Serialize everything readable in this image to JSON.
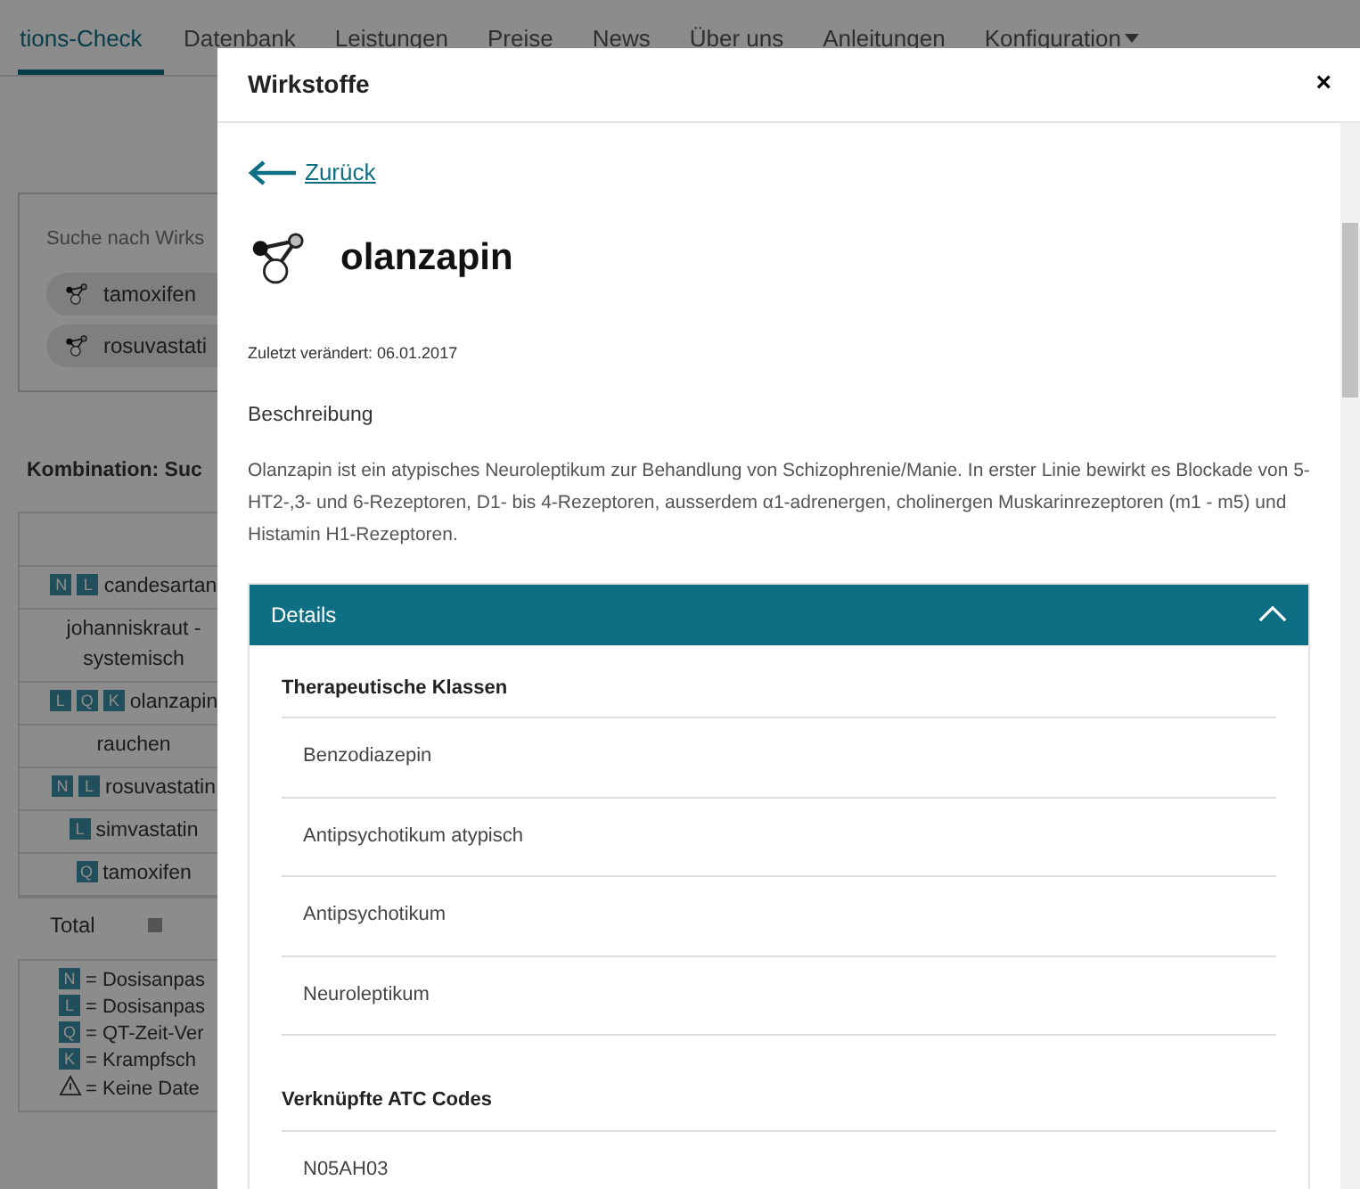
{
  "navbar": {
    "items": [
      {
        "label": "tions-Check",
        "selected": true,
        "has_menu": false
      },
      {
        "label": "Datenbank",
        "selected": false,
        "has_menu": false
      },
      {
        "label": "Leistungen",
        "selected": false,
        "has_menu": false
      },
      {
        "label": "Preise",
        "selected": false,
        "has_menu": false
      },
      {
        "label": "News",
        "selected": false,
        "has_menu": false
      },
      {
        "label": "Über uns",
        "selected": false,
        "has_menu": false
      },
      {
        "label": "Anleitungen",
        "selected": false,
        "has_menu": false
      },
      {
        "label": "Konfiguration",
        "selected": false,
        "has_menu": true
      }
    ]
  },
  "search": {
    "placeholder": "Suche nach Wirks"
  },
  "chips": [
    {
      "label": "tamoxifen"
    },
    {
      "label": "rosuvastati"
    }
  ],
  "combination_title": "Kombination: Suc",
  "table": {
    "rows": [
      {
        "badges": [
          "N",
          "L"
        ],
        "name": "candesartan"
      },
      {
        "badges": [],
        "name": "johanniskraut - systemisch"
      },
      {
        "badges": [
          "L",
          "Q",
          "K"
        ],
        "name": "olanzapin"
      },
      {
        "badges": [],
        "name": "rauchen"
      },
      {
        "badges": [
          "N",
          "L"
        ],
        "name": "rosuvastatin"
      },
      {
        "badges": [
          "L"
        ],
        "name": "simvastatin"
      },
      {
        "badges": [
          "Q"
        ],
        "name": "tamoxifen"
      }
    ],
    "total": "Total"
  },
  "legend": [
    {
      "kind": "badge",
      "letter": "N",
      "text": "= Dosisanpas"
    },
    {
      "kind": "badge",
      "letter": "L",
      "text": "= Dosisanpas"
    },
    {
      "kind": "badge",
      "letter": "Q",
      "text": "= QT-Zeit-Ver"
    },
    {
      "kind": "badge",
      "letter": "K",
      "text": "= Krampfsch"
    },
    {
      "kind": "warning",
      "text": "= Keine Date"
    }
  ],
  "modal": {
    "title": "Wirkstoffe",
    "close": "×",
    "back_link": "Zurück",
    "substance": "olanzapin",
    "modified": "Zuletzt verändert: 06.01.2017",
    "description_heading": "Beschreibung",
    "description": "Olanzapin ist ein atypisches Neuroleptikum zur Behandlung von Schizophrenie/Manie. In erster Linie bewirkt es Blockade von 5-HT2-,3- und 6-Rezeptoren, D1- bis 4-Rezeptoren, ausserdem α1-adrenergen, cholinergen Muskarinrezeptoren (m1 - m5) und Histamin H1-Rezeptoren.",
    "details": {
      "title": "Details",
      "expanded": true,
      "sections": [
        {
          "heading": "Therapeutische Klassen",
          "items": [
            "Benzodiazepin",
            "Antipsychotikum atypisch",
            "Antipsychotikum",
            "Neuroleptikum"
          ]
        },
        {
          "heading": "Verknüpfte ATC Codes",
          "items": [
            "N05AH03"
          ]
        }
      ]
    }
  }
}
